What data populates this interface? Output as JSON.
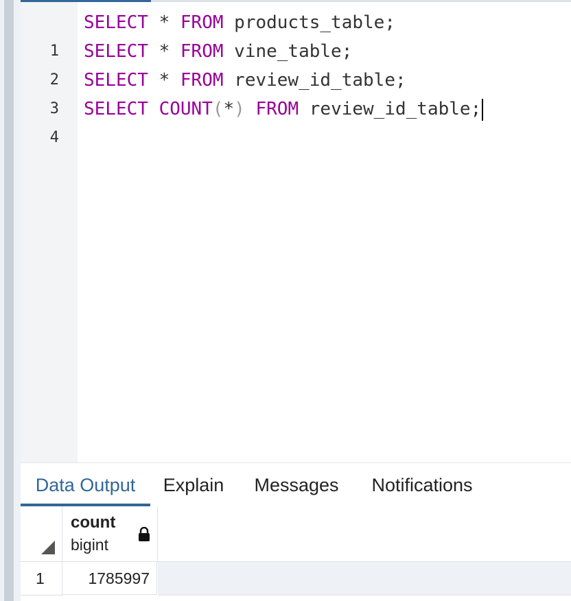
{
  "editor": {
    "lines": [
      {
        "num": "1",
        "kw1": "SELECT",
        "star": " * ",
        "kw2": "FROM",
        "rest": " products_table;"
      },
      {
        "num": "2",
        "kw1": "SELECT",
        "star": " * ",
        "kw2": "FROM",
        "rest": " vine_table;"
      },
      {
        "num": "3",
        "kw1": "SELECT",
        "star": " * ",
        "kw2": "FROM",
        "rest": " review_id_table;"
      },
      {
        "num": "4",
        "kw1": "SELECT",
        "fn": "COUNT",
        "lparen": "(",
        "star": "*",
        "rparen": ")",
        "kw2": "FROM",
        "rest": " review_id_table;"
      }
    ]
  },
  "tabs": {
    "data_output": "Data Output",
    "explain": "Explain",
    "messages": "Messages",
    "notifications": "Notifications"
  },
  "result": {
    "column_name": "count",
    "column_type": "bigint",
    "rows": [
      {
        "num": "1",
        "value": "1785997"
      }
    ]
  },
  "colors": {
    "accent": "#336699",
    "keyword": "#990099"
  }
}
